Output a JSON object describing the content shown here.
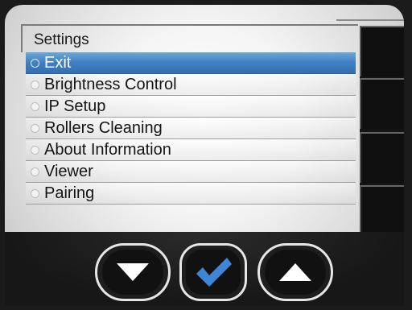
{
  "menu": {
    "title": "Settings",
    "items": [
      {
        "label": "Exit",
        "selected": true
      },
      {
        "label": "Brightness Control",
        "selected": false
      },
      {
        "label": "IP Setup",
        "selected": false
      },
      {
        "label": "Rollers Cleaning",
        "selected": false
      },
      {
        "label": "About Information",
        "selected": false
      },
      {
        "label": "Viewer",
        "selected": false
      },
      {
        "label": "Pairing",
        "selected": false
      }
    ]
  },
  "controls": {
    "down_icon": "triangle-down-icon",
    "confirm_icon": "checkmark-icon",
    "up_icon": "triangle-up-icon"
  },
  "colors": {
    "selection": "#3f7fc2",
    "checkmark": "#3e86d6",
    "device_body": "#1b1b1b",
    "button_outline": "#e6e6e6"
  }
}
